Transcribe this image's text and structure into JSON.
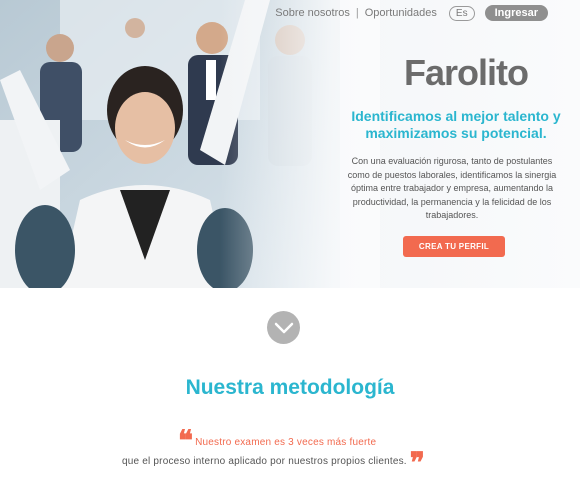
{
  "nav": {
    "about": "Sobre nosotros",
    "separator": "|",
    "opportunities": "Oportunidades",
    "language": "Es",
    "login": "Ingresar"
  },
  "brand": {
    "logo_text_a": "Farol",
    "logo_text_b": "ito"
  },
  "hero": {
    "tagline": "Identificamos al mejor talento y maximizamos su potencial.",
    "description": "Con una evaluación rigurosa, tanto de postulantes como de puestos laborales, identificamos la sinergia óptima entre trabajador y empresa, aumentando la productividad, la permanencia y la felicidad de los trabajadores.",
    "cta": "CREA TU PERFIL"
  },
  "scroll": {
    "icon": "chevron-down-icon"
  },
  "methodology": {
    "title": "Nuestra metodología",
    "quote_line1": "Nuestro examen es 3 veces más fuerte",
    "quote_line2": "que el proceso interno aplicado por nuestros propios clientes."
  },
  "colors": {
    "accent": "#2bb6cf",
    "cta": "#f26a4f",
    "login_bg": "#8f8f8f"
  }
}
